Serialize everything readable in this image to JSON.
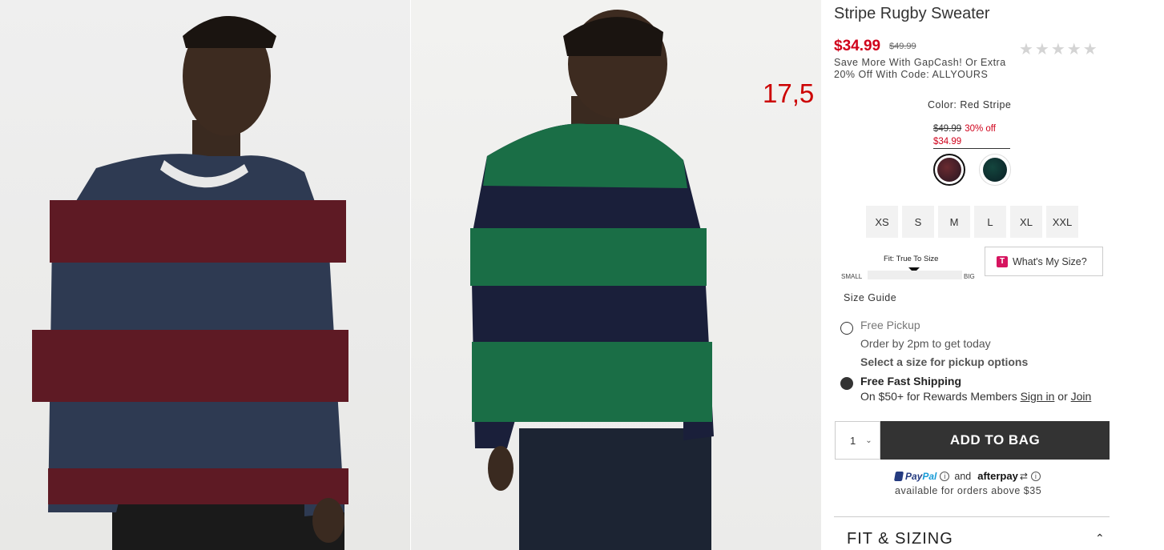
{
  "product": {
    "title": "Stripe Rugby Sweater",
    "sale_price": "$34.99",
    "original_price": "$49.99",
    "promo_text": "Save More With GapCash! Or Extra 20% Off With Code: ALLYOURS",
    "rating_stars": "★★★★★"
  },
  "overlay_number": "17,5",
  "color": {
    "label": "Color: Red Stripe",
    "swatch_original": "$49.99",
    "swatch_discount": "30% off",
    "swatch_sale": "$34.99",
    "swatches": [
      "red-stripe",
      "green-stripe"
    ]
  },
  "sizes": [
    "XS",
    "S",
    "M",
    "L",
    "XL",
    "XXL"
  ],
  "fit": {
    "label": "Fit: True To Size",
    "small": "SMALL",
    "big": "BIG",
    "whats_my_size_logo": "T",
    "whats_my_size": "What's My Size?"
  },
  "size_guide": "Size Guide",
  "fulfillment": {
    "pickup_title": "Free Pickup",
    "pickup_sub": "Order by 2pm to get today",
    "pickup_select": "Select a size for pickup options",
    "ship_title": "Free Fast Shipping",
    "ship_sub": "On $50+ for Rewards Members",
    "sign_in": "Sign in",
    "or": "or",
    "join": "Join"
  },
  "cart": {
    "quantity": "1",
    "add_to_bag": "ADD TO BAG"
  },
  "payments": {
    "paypal_a": "Pay",
    "paypal_b": "Pal",
    "and": "and",
    "afterpay": "afterpay",
    "note": "available for orders above $35"
  },
  "sections": {
    "fit_sizing": "FIT & SIZING"
  },
  "colors": {
    "sale_red": "#d0021b",
    "button_dark": "#333333",
    "sweater_navy": "#2e3a52",
    "sweater_burgundy": "#5e1a24",
    "sweater_green": "#1a6e46"
  }
}
